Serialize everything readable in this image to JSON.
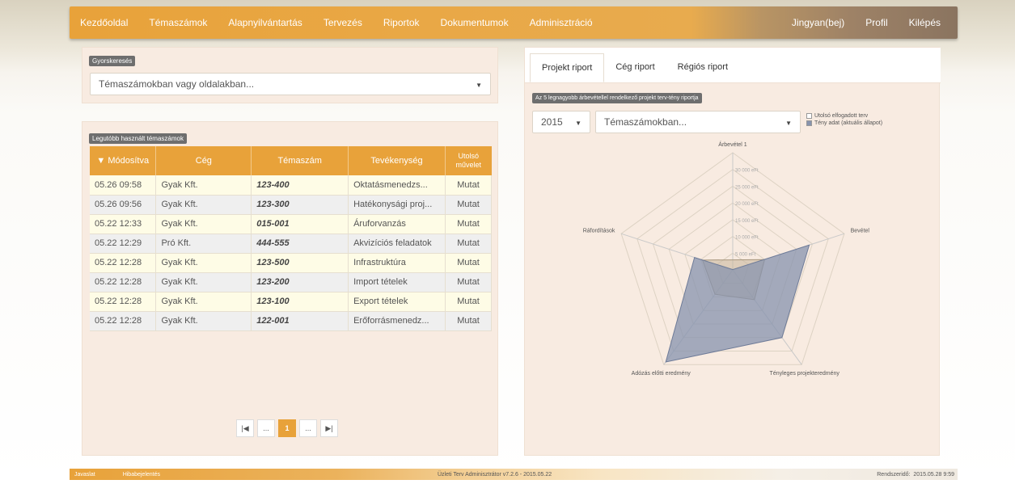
{
  "nav": {
    "left": [
      "Kezdőoldal",
      "Témaszámok",
      "Alapnyilvántartás",
      "Tervezés",
      "Riportok",
      "Dokumentumok",
      "Adminisztráció"
    ],
    "right": [
      "Jingyan(bej)",
      "Profil",
      "Kilépés"
    ]
  },
  "search": {
    "tag": "Gyorskeresés",
    "placeholder": "Témaszámokban vagy oldalakban..."
  },
  "table": {
    "tag": "Legutóbb használt témaszámok",
    "headers": [
      "▼ Módosítva",
      "Cég",
      "Témaszám",
      "Tevékenység",
      "Utolsó művelet"
    ],
    "rows": [
      [
        "05.26 09:58",
        "Gyak Kft.",
        "123-400",
        "Oktatásmenedzs...",
        "Mutat"
      ],
      [
        "05.26 09:56",
        "Gyak Kft.",
        "123-300",
        "Hatékonysági proj...",
        "Mutat"
      ],
      [
        "05.22 12:33",
        "Gyak Kft.",
        "015-001",
        "Áruforvanzás",
        "Mutat"
      ],
      [
        "05.22 12:29",
        "Pró Kft.",
        "444-555",
        "Akvizíciós feladatok",
        "Mutat"
      ],
      [
        "05.22 12:28",
        "Gyak Kft.",
        "123-500",
        "Infrastruktúra",
        "Mutat"
      ],
      [
        "05.22 12:28",
        "Gyak Kft.",
        "123-200",
        "Import tételek",
        "Mutat"
      ],
      [
        "05.22 12:28",
        "Gyak Kft.",
        "123-100",
        "Export tételek",
        "Mutat"
      ],
      [
        "05.22 12:28",
        "Gyak Kft.",
        "122-001",
        "Erőforrásmenedz...",
        "Mutat"
      ]
    ],
    "pager": [
      "|◀",
      "...",
      "1",
      "...",
      "▶|"
    ]
  },
  "report": {
    "tabs": [
      "Projekt riport",
      "Cég riport",
      "Régiós riport"
    ],
    "tag": "Az 5 legnagyobb árbevétellel rendelkező projekt terv-tény riportja",
    "year": "2015",
    "filter_placeholder": "Témaszámokban...",
    "legend": [
      "Utolsó elfogadott terv",
      "Tény adat (aktuális állapot)"
    ]
  },
  "chart_data": {
    "type": "radar",
    "axes": [
      "Árbevétel 1",
      "Bevétel",
      "Tényleges projekteredmény",
      "Adózás előtti eredmény",
      "Ráfordítások"
    ],
    "ticks": [
      "5 000 eFt",
      "10 000 eFt",
      "15 000 eFt",
      "20 000 eFt",
      "25 000 eFt",
      "30 000 eFt"
    ],
    "rmax": 35000,
    "series": [
      {
        "name": "Utolsó elfogadott terv",
        "values": [
          3000,
          10000,
          11000,
          9000,
          9500
        ],
        "color": "#c7b59b"
      },
      {
        "name": "Tény adat (aktuális állapot)",
        "values": [
          100,
          24000,
          25000,
          34000,
          12000
        ],
        "color": "#8793ad"
      }
    ]
  },
  "footer": {
    "links": [
      "Javaslat",
      "Hibabejelentés"
    ],
    "version": "Üzleti Terv Adminisztrátor v7.2.6 - 2015.05.22",
    "clock_label": "Rendszeridő:",
    "clock": "2015.05.28 9:59"
  }
}
